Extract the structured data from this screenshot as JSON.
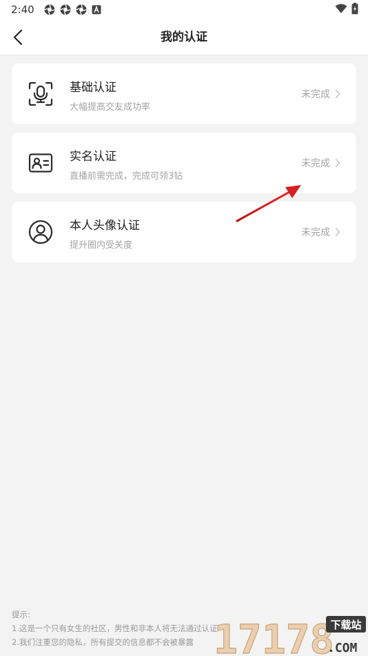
{
  "status_bar": {
    "time": "2:40",
    "notification_icons": [
      "aperture-icon",
      "aperture-icon",
      "aperture-icon",
      "letter-a-icon"
    ],
    "right_icons": [
      "wifi-icon",
      "battery-icon"
    ]
  },
  "navbar": {
    "title": "我的认证",
    "back_icon": "chevron-left-icon"
  },
  "items": [
    {
      "name": "基础认证",
      "desc": "大幅提高交友成功率",
      "status": "未完成",
      "icon": "voice-scan-icon"
    },
    {
      "name": "实名认证",
      "desc": "直播前需完成，完成可领3钻",
      "status": "未完成",
      "icon": "id-card-icon"
    },
    {
      "name": "本人头像认证",
      "desc": "提升圈内受关度",
      "status": "未完成",
      "icon": "avatar-circle-icon"
    }
  ],
  "tips": {
    "title": "提示:",
    "lines": [
      "1.这是一个只有女生的社区，男性和非本人将无法通过认证",
      "2.我们注重您的隐私，所有提交的信息都不会被暴露"
    ]
  },
  "watermark": {
    "number": "17178",
    "site": "下载站",
    "domain": ".COM"
  },
  "colors": {
    "background": "#f3f3f3",
    "card": "#ffffff",
    "status_text": "#a5a5a5",
    "annotation_arrow": "#d42020"
  }
}
